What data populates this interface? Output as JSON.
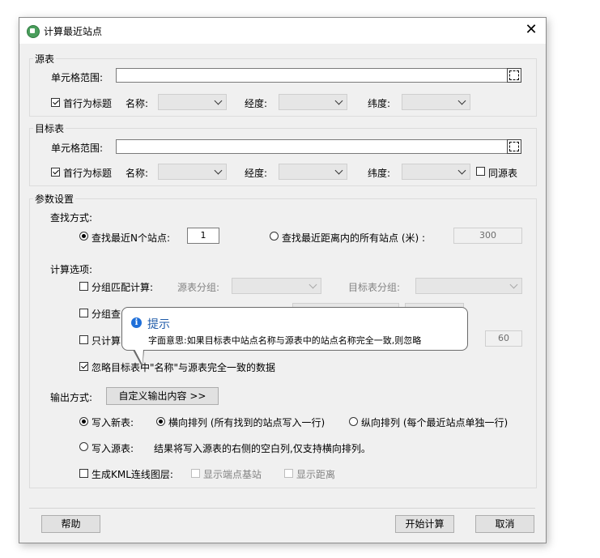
{
  "window": {
    "title": "计算最近站点",
    "close": "✕"
  },
  "source": {
    "group_label": "源表",
    "range_label": "单元格范围:",
    "range_value": "",
    "header_row_label": "首行为标题",
    "header_row_checked": true,
    "name_label": "名称:",
    "lon_label": "经度:",
    "lat_label": "纬度:"
  },
  "target": {
    "group_label": "目标表",
    "range_label": "单元格范围:",
    "range_value": "",
    "header_row_label": "首行为标题",
    "header_row_checked": true,
    "name_label": "名称:",
    "lon_label": "经度:",
    "lat_label": "纬度:",
    "same_as_source_label": "同源表"
  },
  "params": {
    "group_label": "参数设置",
    "find_mode_label": "查找方式:",
    "nearest_n_label": "查找最近N个站点:",
    "nearest_n_value": "1",
    "within_dist_label": "查找最近距离内的所有站点 (米) :",
    "within_dist_value": "300",
    "calc_options_label": "计算选项:",
    "group_match_label": "分组匹配计算:",
    "source_group_label": "源表分组:",
    "target_group_label": "目标表分组:",
    "group_find_label": "分组查",
    "only_calc_label": "只计算",
    "only_calc_value": "60",
    "ignore_same_label": "忽略目标表中\"名称\"与源表完全一致的数据",
    "output_mode_label": "输出方式:",
    "custom_output_button": "自定义输出内容 >>",
    "write_new_label": "写入新表:",
    "horizontal_label": "横向排列 (所有找到的站点写入一行)",
    "vertical_label": "纵向排列 (每个最近站点单独一行)",
    "write_source_label": "写入源表:",
    "write_source_note": "结果将写入源表的右侧的空白列,仅支持横向排列。",
    "kml_label": "生成KML连线图层:",
    "show_endpoint_label": "显示端点基站",
    "show_distance_label": "显示距离"
  },
  "tooltip": {
    "title": "提示",
    "text": "字面意思:如果目标表中站点名称与源表中的站点名称完全一致,则忽略"
  },
  "buttons": {
    "help": "帮助",
    "start": "开始计算",
    "cancel": "取消"
  },
  "icons": {
    "app": "app-icon",
    "info": "info-icon",
    "range_picker": "range-select-icon"
  }
}
